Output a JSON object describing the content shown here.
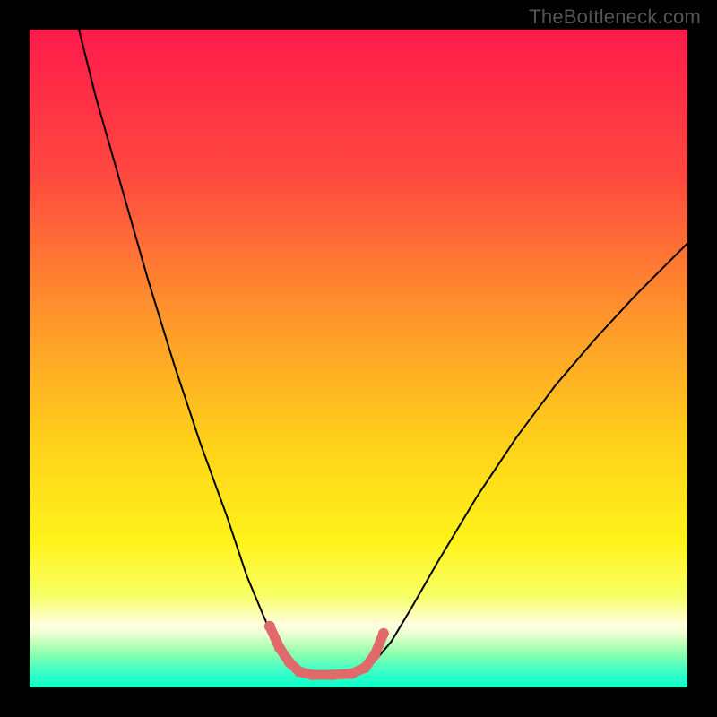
{
  "watermark": "TheBottleneck.com",
  "chart_data": {
    "type": "line",
    "title": "",
    "xlabel": "",
    "ylabel": "",
    "xlim": [
      0,
      100
    ],
    "ylim": [
      0,
      100
    ],
    "grid": false,
    "legend": false,
    "background_gradient": {
      "stops": [
        {
          "offset": 0.0,
          "color": "#ff1a4b"
        },
        {
          "offset": 0.22,
          "color": "#ff4840"
        },
        {
          "offset": 0.45,
          "color": "#ff9a2a"
        },
        {
          "offset": 0.63,
          "color": "#ffd21a"
        },
        {
          "offset": 0.78,
          "color": "#fff31a"
        },
        {
          "offset": 0.86,
          "color": "#f8ff66"
        },
        {
          "offset": 0.905,
          "color": "#ffffe0"
        },
        {
          "offset": 0.92,
          "color": "#e8ffd0"
        },
        {
          "offset": 0.935,
          "color": "#b8ffb8"
        },
        {
          "offset": 0.95,
          "color": "#8affb0"
        },
        {
          "offset": 0.965,
          "color": "#5affc0"
        },
        {
          "offset": 0.98,
          "color": "#30ffc8"
        },
        {
          "offset": 1.0,
          "color": "#0affc8"
        }
      ]
    },
    "series": [
      {
        "name": "bottleneck-curve",
        "color": "#000000",
        "width": 2,
        "x": [
          7.5,
          10,
          14,
          18,
          22,
          26,
          30,
          33,
          35.5,
          37.5,
          39,
          40.5,
          42,
          45,
          48,
          50,
          52.5,
          55,
          58,
          62,
          68,
          74,
          80,
          86,
          92,
          98,
          100
        ],
        "y": [
          100,
          90,
          76,
          62,
          49,
          37,
          26,
          17,
          11,
          6.5,
          4,
          2.5,
          2,
          2,
          2,
          2.5,
          4,
          7,
          12,
          19,
          29,
          38,
          46,
          53,
          59.5,
          65.5,
          67.5
        ]
      },
      {
        "name": "optimal-zone-marker",
        "color": "#e06a6a",
        "width": 11,
        "linecap": "round",
        "dots": true,
        "dot_radius": 6,
        "x": [
          36.5,
          38,
          39.5,
          41,
          43,
          46,
          49,
          51,
          52.5,
          53.8
        ],
        "y": [
          9.3,
          6.0,
          3.8,
          2.4,
          1.9,
          1.9,
          2.1,
          3.0,
          5.0,
          8.2
        ]
      }
    ]
  }
}
